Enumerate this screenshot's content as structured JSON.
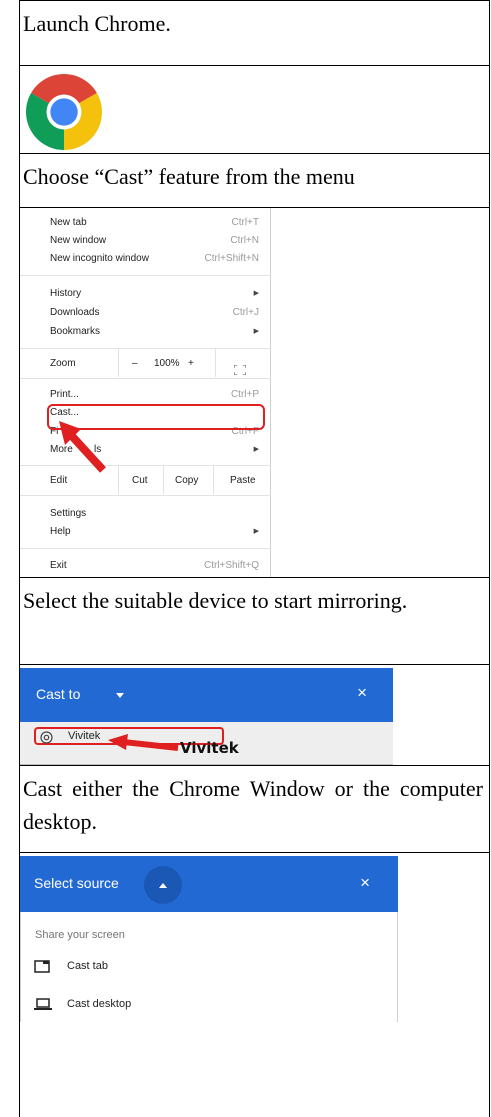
{
  "steps": [
    {
      "text": "Launch Chrome."
    },
    {
      "text": "Choose “Cast” feature from the menu"
    },
    {
      "text": "Select the suitable device to start mirroring."
    },
    {
      "text": "Cast either the Chrome Window or the computer desktop."
    }
  ],
  "chrome_menu": {
    "new_tab": "New tab",
    "new_tab_sc": "Ctrl+T",
    "new_window": "New window",
    "new_window_sc": "Ctrl+N",
    "incognito": "New incognito window",
    "incognito_sc": "Ctrl+Shift+N",
    "history": "History",
    "downloads": "Downloads",
    "downloads_sc": "Ctrl+J",
    "bookmarks": "Bookmarks",
    "zoom": "Zoom",
    "zoom_minus": "–",
    "zoom_level": "100%",
    "zoom_plus": "+",
    "print": "Print...",
    "print_sc": "Ctrl+P",
    "cast": "Cast...",
    "find": "Fi",
    "find_sc": "Ctrl+F",
    "more_tools_start": "More",
    "more_tools_end": "ls",
    "edit": "Edit",
    "cut": "Cut",
    "copy": "Copy",
    "paste": "Paste",
    "settings": "Settings",
    "help": "Help",
    "exit": "Exit",
    "exit_sc": "Ctrl+Shift+Q"
  },
  "cast_dialog": {
    "title": "Cast to",
    "close": "×",
    "device": "Vivitek",
    "callout": "Vivitek"
  },
  "source_dialog": {
    "title": "Select source",
    "close": "×",
    "section": "Share your screen",
    "option_tab": "Cast tab",
    "option_desktop": "Cast desktop"
  },
  "colors": {
    "dialog_header": "#2369d3",
    "highlight_red": "#e02020",
    "chrome_red": "#db4437",
    "chrome_yellow": "#f4c20d",
    "chrome_green": "#0f9d58",
    "chrome_blue": "#4285f4"
  }
}
